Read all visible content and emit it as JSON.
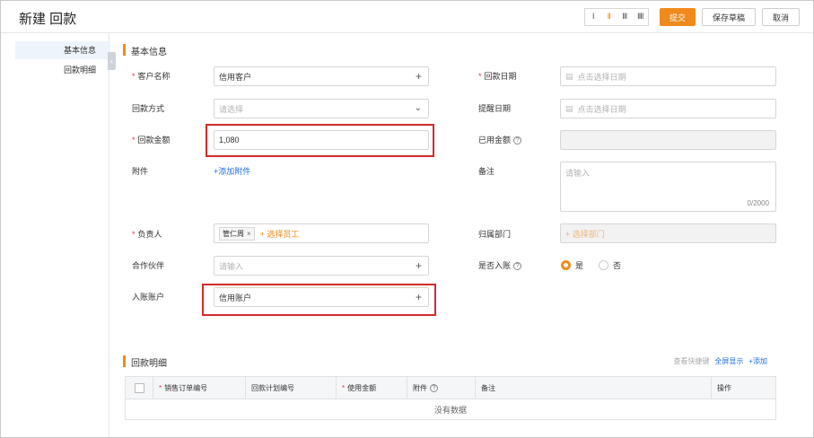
{
  "header": {
    "title": "新建 回款",
    "view_toggle": [
      "I",
      "II",
      "III",
      "IIII"
    ],
    "submit_label": "提交",
    "save_draft_label": "保存草稿",
    "cancel_label": "取消"
  },
  "sidebar": {
    "items": [
      {
        "label": "基本信息"
      },
      {
        "label": "回款明细"
      }
    ]
  },
  "basic": {
    "section_title": "基本信息",
    "customer": {
      "label": "客户名称",
      "value": "信用客户"
    },
    "payment_date": {
      "label": "回款日期",
      "placeholder": "点击选择日期"
    },
    "payment_method": {
      "label": "回款方式",
      "placeholder": "请选择"
    },
    "reminder_date": {
      "label": "提醒日期",
      "placeholder": "点击选择日期"
    },
    "amount": {
      "label": "回款金额",
      "value": "1,080"
    },
    "used_amount": {
      "label": "已用金额"
    },
    "attachment": {
      "label": "附件",
      "add_label": "+添加附件"
    },
    "remark": {
      "label": "备注",
      "placeholder": "请输入",
      "counter": "0/2000"
    },
    "owner": {
      "label": "负责人",
      "tag": "管仁周",
      "select_label": "+ 选择员工"
    },
    "department": {
      "label": "归属部门",
      "select_label": "+ 选择部门"
    },
    "partner": {
      "label": "合作伙伴",
      "placeholder": "请输入"
    },
    "posted": {
      "label": "是否入账",
      "yes": "是",
      "no": "否",
      "selected": "是"
    },
    "account": {
      "label": "入账账户",
      "value": "信用账户"
    }
  },
  "details": {
    "section_title": "回款明细",
    "actions": {
      "shortcut": "查看快捷键",
      "fullscreen": "全屏显示",
      "add": "+添加"
    },
    "columns": [
      "销售订单编号",
      "回款计划编号",
      "使用金额",
      "附件",
      "备注",
      "操作"
    ],
    "empty_text": "没有数据"
  },
  "colors": {
    "accent": "#f08a1c",
    "link": "#1f6fe0",
    "highlight": "#d22a2a"
  },
  "icons": {
    "add": "plus-icon",
    "dropdown": "chevron-down-icon",
    "date": "calendar-icon",
    "help": "question-circle-icon",
    "collapse": "chevron-left-icon"
  }
}
